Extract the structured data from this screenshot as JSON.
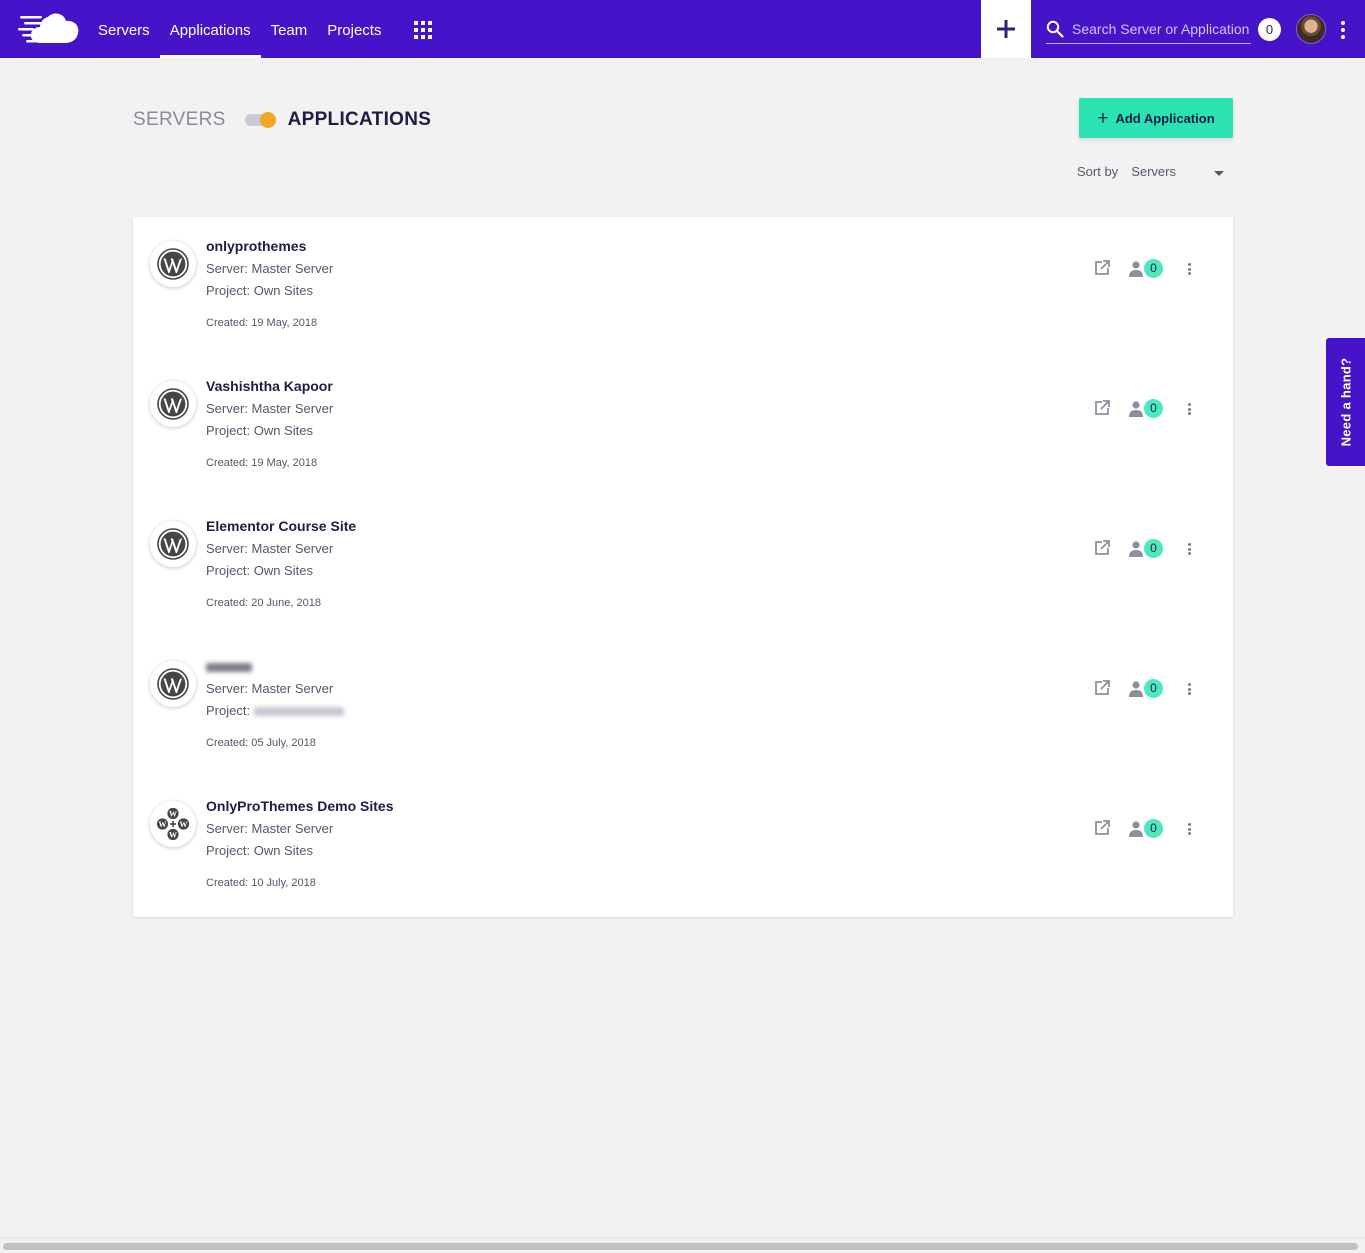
{
  "nav": {
    "links": [
      "Servers",
      "Applications",
      "Team",
      "Projects"
    ],
    "active_link": "Applications",
    "search_placeholder": "Search Server or Application",
    "notification_count": "0"
  },
  "header": {
    "toggle_left": "SERVERS",
    "toggle_right": "APPLICATIONS",
    "add_button": "Add Application",
    "sort_label": "Sort by",
    "sort_value": "Servers"
  },
  "apps": [
    {
      "name": "onlyprothemes",
      "server": "Server: Master Server",
      "project_prefix": "Project:",
      "project": "Own Sites",
      "created": "Created: 19 May, 2018",
      "collaborators": "0"
    },
    {
      "name": "Vashishtha Kapoor",
      "server": "Server: Master Server",
      "project_prefix": "Project:",
      "project": "Own Sites",
      "created": "Created: 19 May, 2018",
      "collaborators": "0"
    },
    {
      "name": "Elementor Course Site",
      "server": "Server: Master Server",
      "project_prefix": "Project:",
      "project": "Own Sites",
      "created": "Created: 20 June, 2018",
      "collaborators": "0"
    },
    {
      "name": "",
      "server": "Server: Master Server",
      "project_prefix": "Project:",
      "project": "",
      "created": "Created: 05 July, 2018",
      "collaborators": "0"
    },
    {
      "name": "OnlyProThemes Demo Sites",
      "server": "Server: Master Server",
      "project_prefix": "Project:",
      "project": "Own Sites",
      "created": "Created: 10 July, 2018",
      "collaborators": "0"
    }
  ],
  "help_tab": "Need a hand?",
  "colors": {
    "navbar": "#4614c8",
    "accent_green": "#2ae3b0",
    "toggle_orange": "#f5a623",
    "background": "#f2f2f2"
  },
  "icons": [
    "cloud-logo-icon",
    "apps-grid-icon",
    "plus-icon",
    "search-icon",
    "avatar",
    "kebab-menu-icon",
    "wordpress-icon",
    "wordpress-multisite-icon",
    "external-link-icon",
    "user-icon"
  ]
}
